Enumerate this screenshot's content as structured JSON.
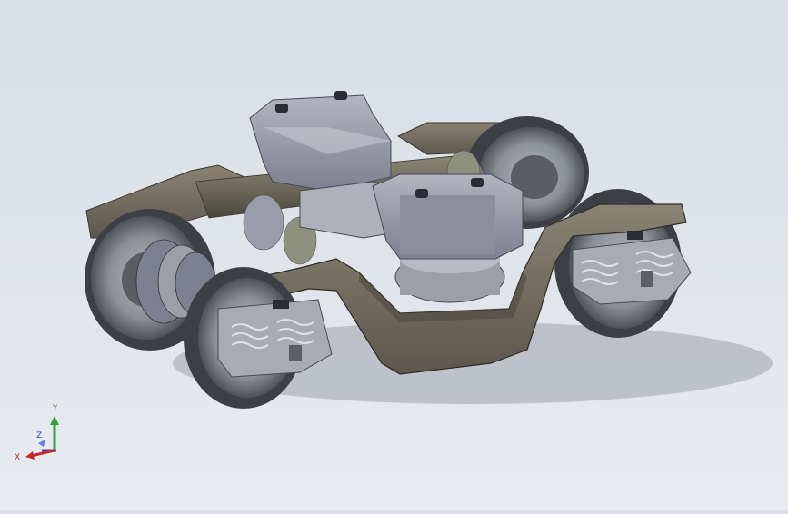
{
  "viewport": {
    "background_top": "#d9dee7",
    "background_bottom": "#e8ebf0",
    "model": {
      "subject": "bogie-assembly",
      "frame_color": "#6b6558",
      "frame_highlight": "#8a8374",
      "wheel_color": "#8b8f97",
      "wheel_dark": "#3c3f46",
      "gearbox_color": "#9c9eaa",
      "gearbox_shadow": "#6c6e7a",
      "spring_color": "#d0d2d8"
    }
  },
  "triad": {
    "x_label": "X",
    "y_label": "Y",
    "z_label": "Z",
    "x_color": "#c22a2a",
    "y_color": "#2fa62f",
    "z_color": "#2f3fc2"
  }
}
